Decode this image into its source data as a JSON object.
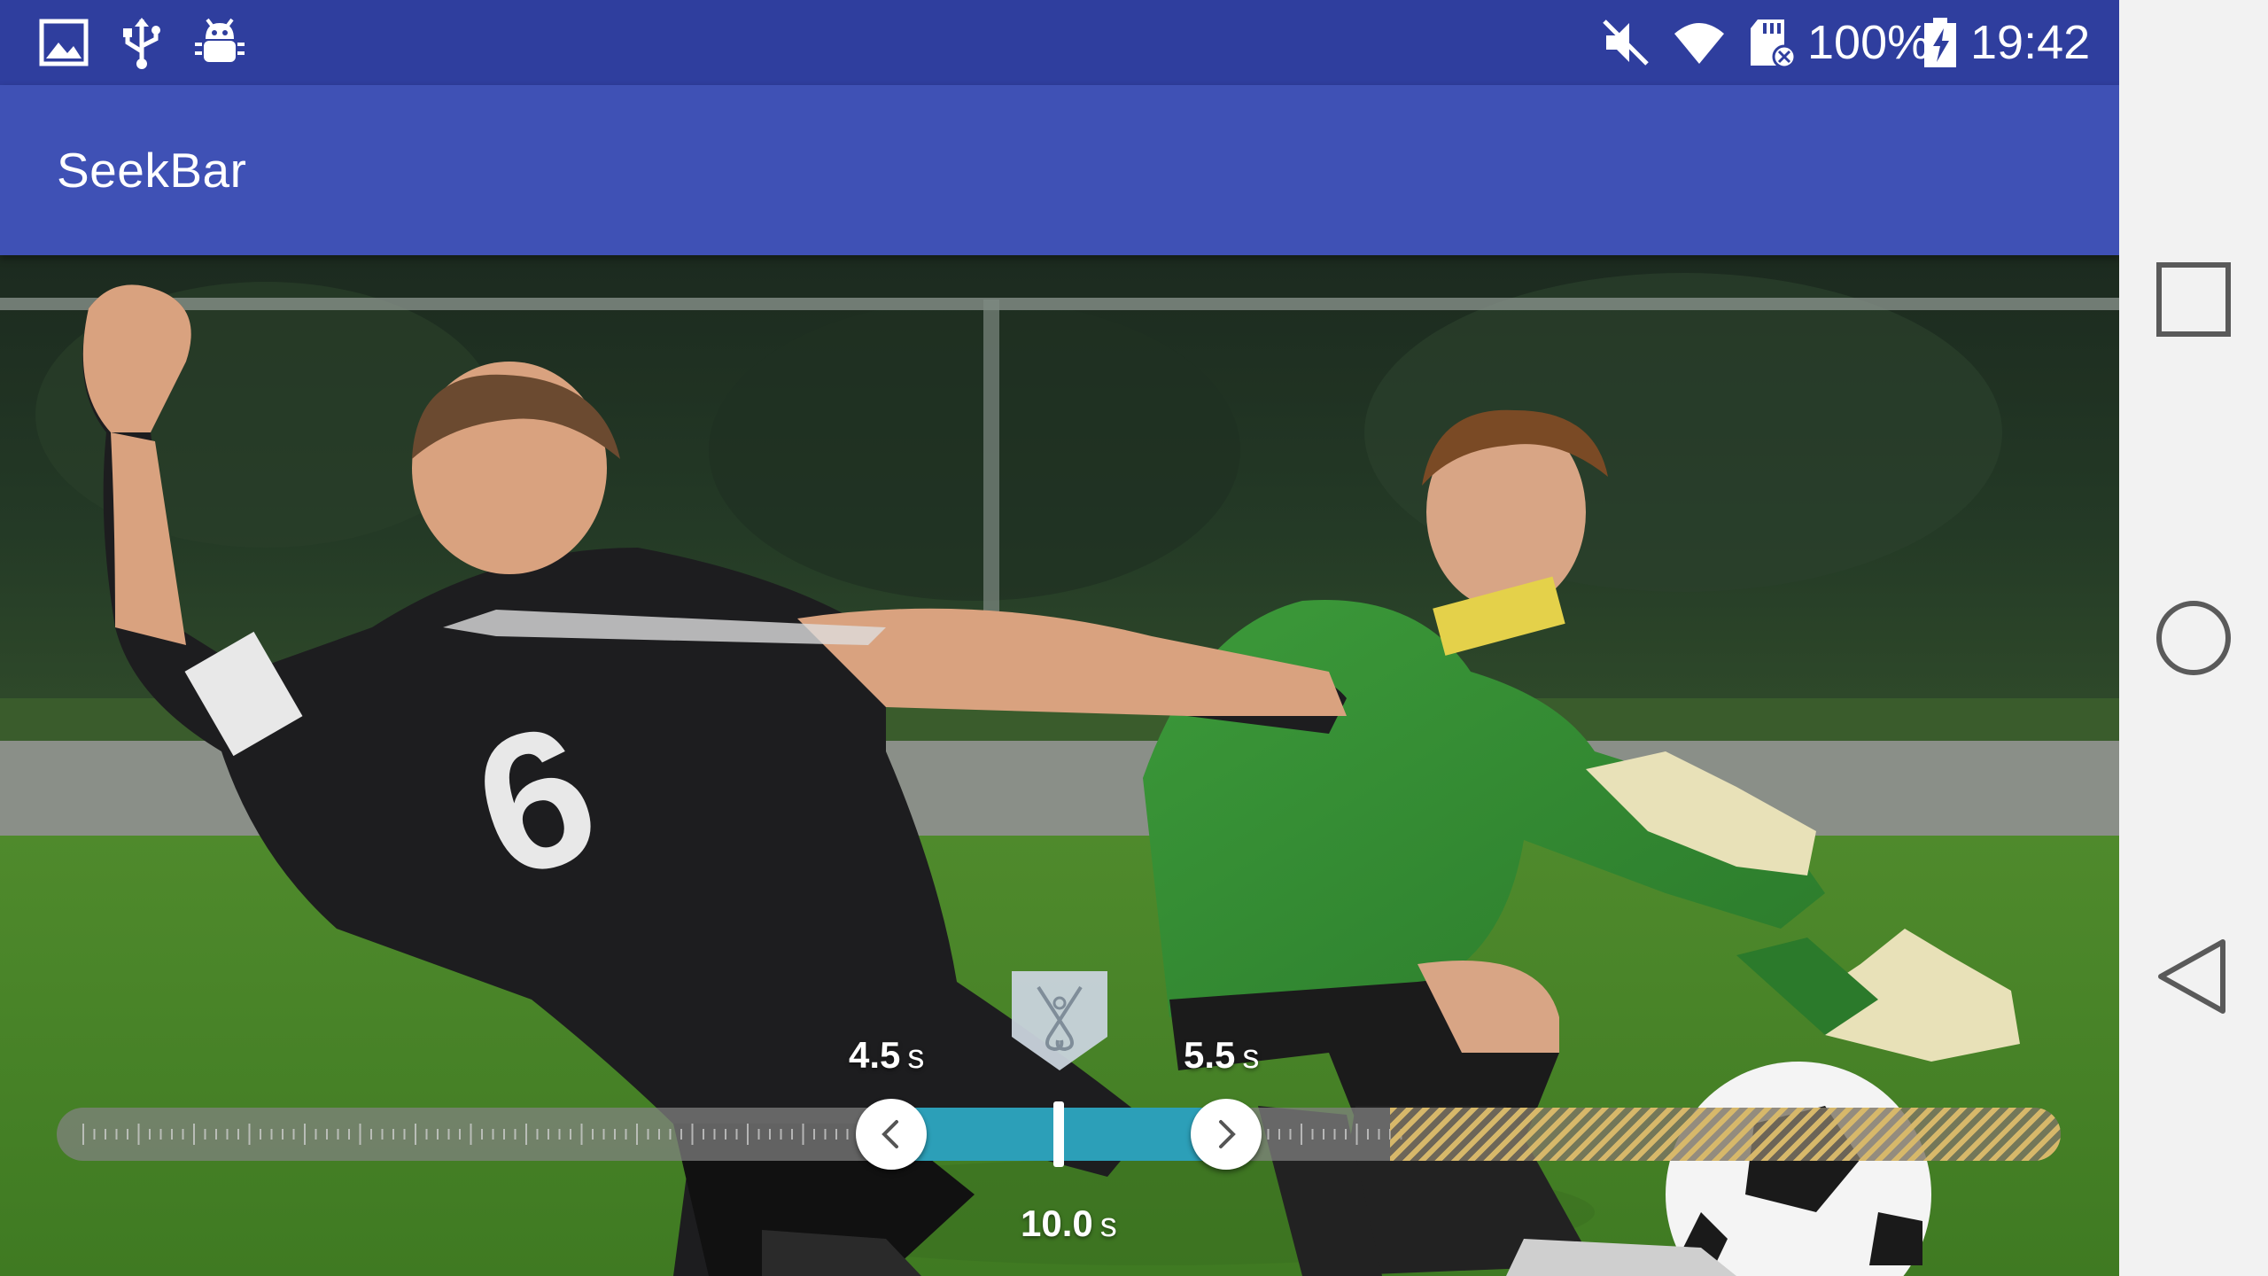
{
  "status_bar": {
    "icons_left": [
      "image-icon",
      "usb-icon",
      "android-debug-icon"
    ],
    "icons_right": [
      "mute-icon",
      "wifi-icon",
      "sd-card-icon",
      "battery-charging-icon"
    ],
    "battery": "100%",
    "time": "19:42",
    "background": "#2f3e9e"
  },
  "app_bar": {
    "title": "SeekBar",
    "background": "#3f51b5"
  },
  "seekbar": {
    "start_value": "4.5",
    "end_value": "5.5",
    "duration_value": "10.0",
    "unit": "s",
    "selection_color": "#2c9fb8",
    "marker_icon": "crossed-sticks-badge-icon",
    "left_handle_icon": "chevron-left-icon",
    "right_handle_icon": "chevron-right-icon"
  },
  "nav_bar": {
    "buttons": [
      "recents-square-icon",
      "home-circle-icon",
      "back-triangle-icon"
    ]
  }
}
